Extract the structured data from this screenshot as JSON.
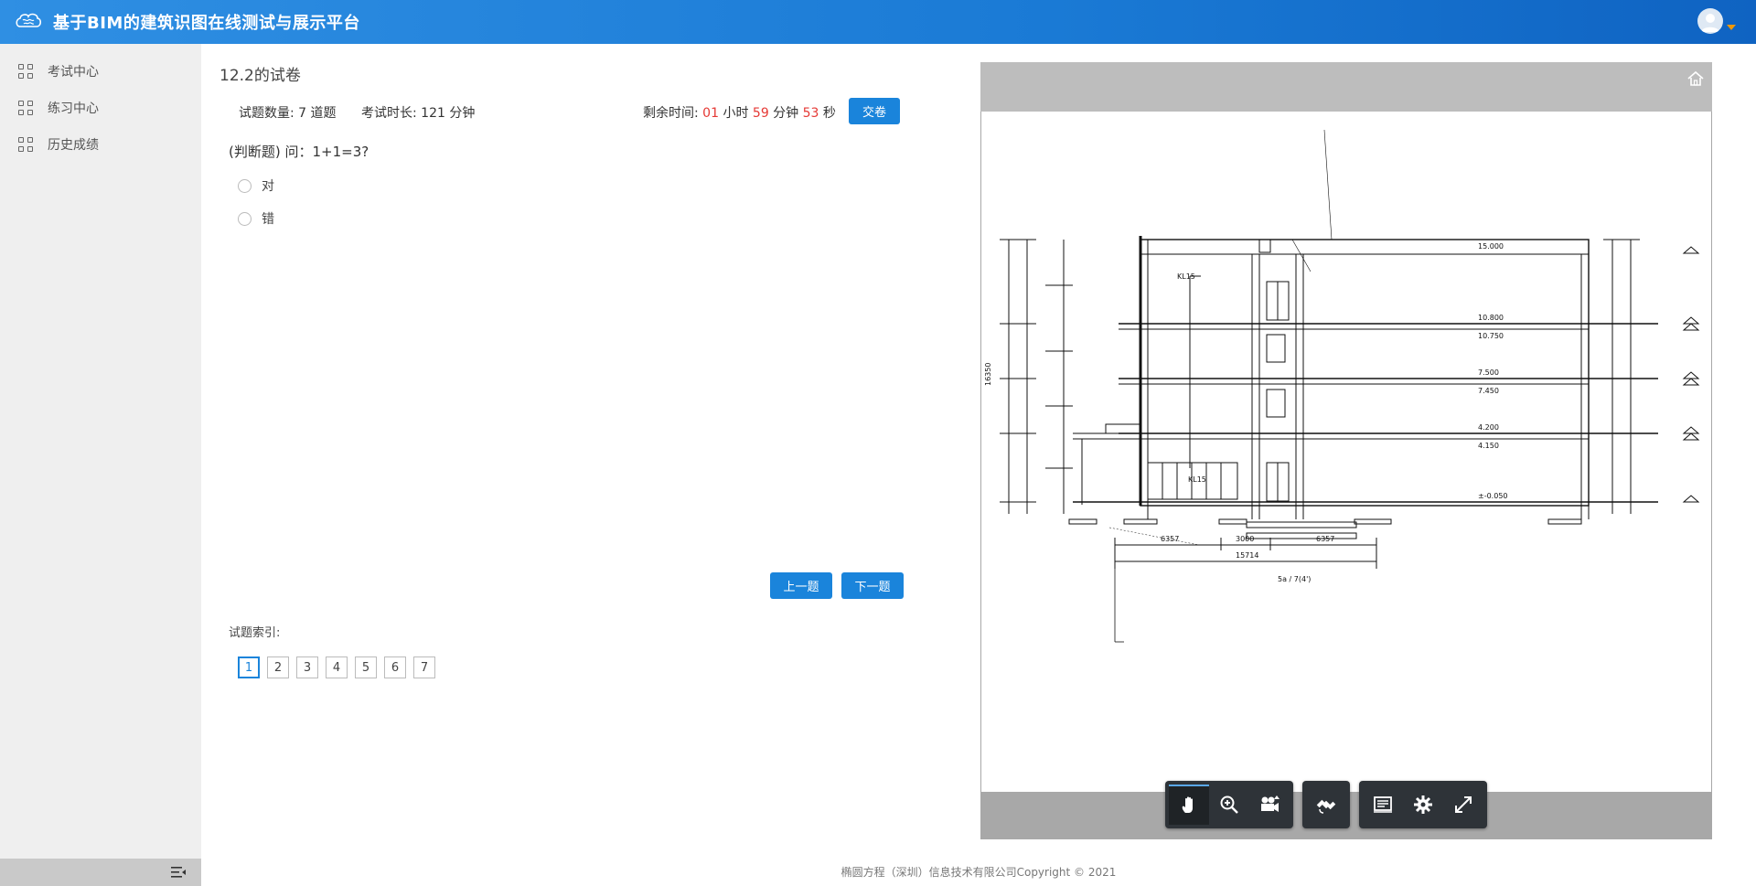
{
  "header": {
    "title": "基于BIM的建筑识图在线测试与展示平台"
  },
  "sidebar": {
    "items": [
      {
        "label": "考试中心"
      },
      {
        "label": "练习中心"
      },
      {
        "label": "历史成绩"
      }
    ]
  },
  "exam": {
    "title": "12.2的试卷",
    "count_label": "试题数量: 7 道题",
    "duration_label": "考试时长: 121 分钟",
    "remaining_prefix": "剩余时间: ",
    "hours": "01",
    "hours_unit": " 小时 ",
    "minutes": "59",
    "minutes_unit": " 分钟 ",
    "seconds": "53",
    "seconds_unit": " 秒",
    "submit_label": "交卷",
    "question": "(判断题) 问：1+1=3?",
    "options": [
      "对",
      "错"
    ],
    "prev_label": "上一题",
    "next_label": "下一题",
    "index_label": "试题索引:",
    "index": [
      "1",
      "2",
      "3",
      "4",
      "5",
      "6",
      "7"
    ],
    "active_index": "1"
  },
  "viewer": {
    "drawing_labels": {
      "elev_15": "15.000",
      "elev_10": "10.800",
      "elev_1075": "10.750",
      "elev_75": "7.500",
      "elev_745": "7.450",
      "elev_42": "4.200",
      "elev_415": "4.150",
      "elev_0": "±-0.050",
      "total_height": "16350",
      "dim_6357a": "6357",
      "dim_3000": "3000",
      "dim_6357b": "6357",
      "dim_total": "15714",
      "kl_a": "KL15",
      "kl_b": "KL15",
      "section_name": "5a / 7(4')"
    },
    "toolbar_icons": [
      "pan-icon",
      "zoom-icon",
      "camera-icon",
      "satellite-icon",
      "model-tree-icon",
      "settings-icon",
      "fullscreen-icon"
    ]
  },
  "footer": {
    "copyright": "椭圆方程（深圳）信息技术有限公司Copyright © 2021"
  },
  "colors": {
    "primary": "#1a84db",
    "header_from": "#2f8fe3",
    "header_to": "#0f63c2",
    "countdown": "#e53935"
  }
}
